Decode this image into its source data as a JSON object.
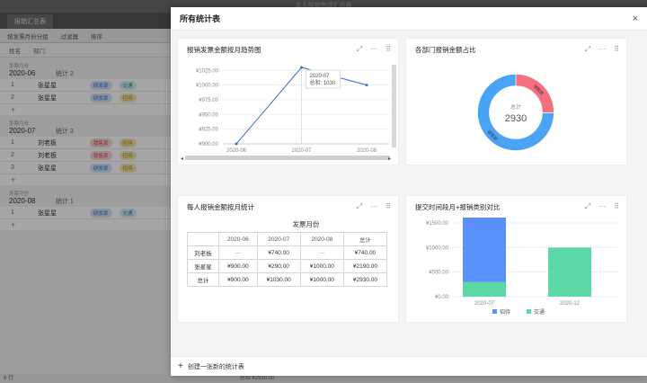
{
  "background": {
    "window_title": "本人报销申请汇总表",
    "tab_label": "报销汇总表",
    "toolbar": [
      "按发票月份分组",
      "过滤器",
      "排序"
    ],
    "columns": [
      "姓名",
      "部门"
    ],
    "groups": [
      {
        "label": "发票月份",
        "date": "2020-06",
        "count": "统计 2",
        "rows": [
          {
            "n": "1",
            "name": "张星星",
            "dept": "研发部",
            "dept_color": "blue",
            "type": "交通",
            "type_color": "teal"
          },
          {
            "n": "2",
            "name": "张星星",
            "dept": "研发部",
            "dept_color": "blue",
            "type": "招待",
            "type_color": "gold"
          }
        ]
      },
      {
        "label": "发票月份",
        "date": "2020-07",
        "count": "统计 3",
        "rows": [
          {
            "n": "1",
            "name": "刘老板",
            "dept": "销售部",
            "dept_color": "red",
            "type": "招待",
            "type_color": "gold"
          },
          {
            "n": "2",
            "name": "刘老板",
            "dept": "销售部",
            "dept_color": "red",
            "type": "招待",
            "type_color": "gold"
          },
          {
            "n": "3",
            "name": "张星星",
            "dept": "研发部",
            "dept_color": "blue",
            "type": "招待",
            "type_color": "gold"
          }
        ]
      },
      {
        "label": "发票月份",
        "date": "2020-08",
        "count": "统计 1",
        "rows": [
          {
            "n": "1",
            "name": "张星星",
            "dept": "研发部",
            "dept_color": "blue",
            "type": "交通",
            "type_color": "teal"
          }
        ]
      }
    ],
    "footer_left": "6 行",
    "footer_sum": "总和 ¥2930.00"
  },
  "modal": {
    "title": "所有统计表",
    "close": "×",
    "footer_add": "创建一张新的统计表"
  },
  "cards": {
    "line": {
      "title": "报销发票金额按月趋势图"
    },
    "donut": {
      "title": "各部门报销金额占比"
    },
    "pivot": {
      "title": "每人报销金额按月统计"
    },
    "stack": {
      "title": "提交时间段月+报销类别对比"
    }
  },
  "chart_data": [
    {
      "type": "line",
      "title": "报销发票金额按月趋势图",
      "x": [
        "2020-06",
        "2020-07",
        "2020-08"
      ],
      "values": [
        900,
        1030,
        1000
      ],
      "ylim": [
        900,
        1030
      ],
      "yticks": [
        "¥900.00",
        "¥925.00",
        "¥950.00",
        "¥975.00",
        "¥1000.00",
        "¥1025.00"
      ],
      "tooltip": {
        "x": "2020-07",
        "label": "总和: 1030"
      },
      "color": "#3f6fc8"
    },
    {
      "type": "pie",
      "title": "各部门报销金额占比",
      "center_label": "总计",
      "total": "2930",
      "slices": [
        {
          "name": "研发部",
          "value": 2190,
          "color": "#4aa3f5"
        },
        {
          "name": "销售部",
          "value": 740,
          "color": "#f2707f"
        }
      ]
    },
    {
      "type": "table",
      "title": "每人报销金额按月统计",
      "column_group": "发票月份",
      "columns": [
        "2020-06",
        "2020-07",
        "2020-08",
        "总计"
      ],
      "rows": [
        {
          "name": "刘老板",
          "cells": [
            "—",
            "¥740.00",
            "—",
            "¥740.00"
          ]
        },
        {
          "name": "张星星",
          "cells": [
            "¥900.00",
            "¥290.00",
            "¥1000.00",
            "¥2190.00"
          ]
        },
        {
          "name": "总计",
          "cells": [
            "¥900.00",
            "¥1030.00",
            "¥1000.00",
            "¥2930.00"
          ]
        }
      ]
    },
    {
      "type": "bar",
      "title": "提交时间段月+报销类别对比",
      "categories": [
        "2020-07",
        "2020-12"
      ],
      "series": [
        {
          "name": "招待",
          "values": [
            1630,
            0
          ],
          "color": "#5b8ff9"
        },
        {
          "name": "交通",
          "values": [
            300,
            1000
          ],
          "color": "#5ad8a6"
        }
      ],
      "ylim": [
        0,
        1500
      ],
      "yticks": [
        "¥0.00",
        "¥500.00",
        "¥1000.00",
        "¥1500.00"
      ]
    }
  ]
}
